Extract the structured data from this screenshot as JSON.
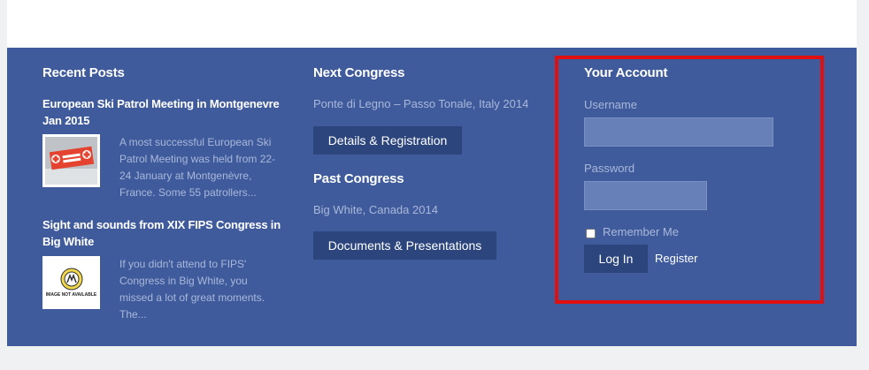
{
  "recent_posts": {
    "heading": "Recent Posts",
    "posts": [
      {
        "title": "European Ski Patrol Meeting in Montgenevre Jan 2015",
        "excerpt": "A most successful European Ski Patrol Meeting was held from 22-24 January at Montgenèvre, France. Some 55 patrollers..."
      },
      {
        "title": "Sight and sounds from XIX FIPS Congress in Big White",
        "excerpt": "If you didn't attend to FIPS' Congress in Big White, you missed a lot of great moments. The...",
        "thumb_caption": "IMAGE NOT AVAILABLE"
      }
    ]
  },
  "congress": {
    "next_heading": "Next Congress",
    "next_location": "Ponte di Legno – Passo Tonale, Italy 2014",
    "details_button": "Details & Registration",
    "past_heading": "Past Congress",
    "past_location": "Big White, Canada 2014",
    "documents_button": "Documents & Presentations"
  },
  "account": {
    "heading": "Your Account",
    "username_label": "Username",
    "username_value": "",
    "password_label": "Password",
    "password_value": "",
    "remember_label": "Remember Me",
    "remember_checked": false,
    "login_button": "Log In",
    "register_link": "Register"
  },
  "colors": {
    "footer_bg": "#3f5b9c",
    "button_bg": "#2c467d",
    "muted_text": "#a9b8da",
    "highlight": "#e01010"
  }
}
